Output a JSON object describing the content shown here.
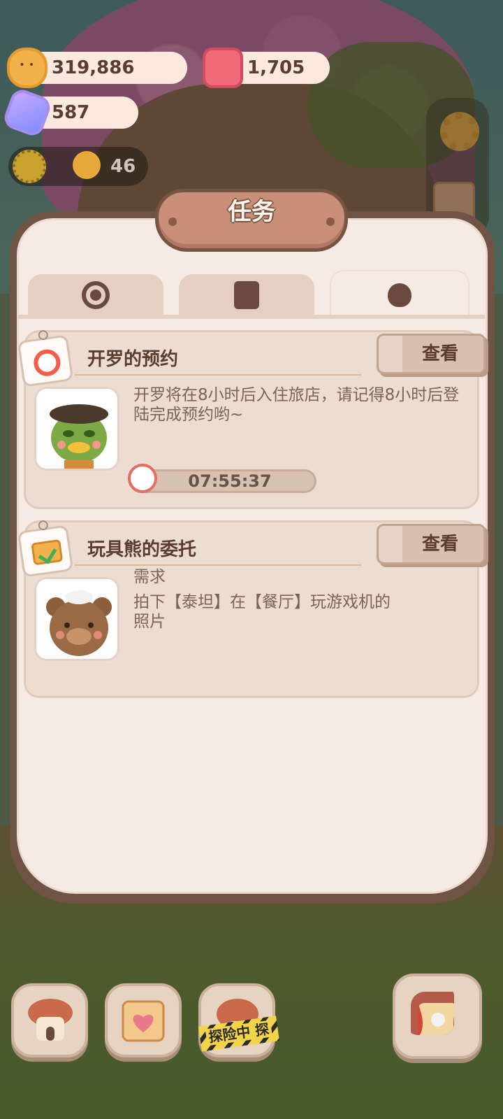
{
  "currency": {
    "cookies": "319,886",
    "jam": "1,705",
    "crystals": "587",
    "stamina": "46"
  },
  "panel": {
    "title": "任务"
  },
  "tabs": [
    {
      "icon": "badge-icon",
      "active": false
    },
    {
      "icon": "cards-icon",
      "active": false
    },
    {
      "icon": "bear-silhouette-icon",
      "active": true
    }
  ],
  "tasks": [
    {
      "title": "开罗的预约",
      "button": "查看",
      "description": "开罗将在8小时后入住旅店，请记得8小时后登陆完成预约哟~",
      "timer": "07:55:37",
      "icon": "alarm-clock-icon",
      "avatar": "green-duck-character"
    },
    {
      "title": "玩具熊的委托",
      "button": "查看",
      "requirement_label": "需求",
      "requirement": "拍下【泰坦】在【餐厅】玩游戏机的照片",
      "icon": "checklist-icon",
      "avatar": "brown-bear-character"
    }
  ],
  "bottom_nav": {
    "explore_label": "探险中 探"
  }
}
